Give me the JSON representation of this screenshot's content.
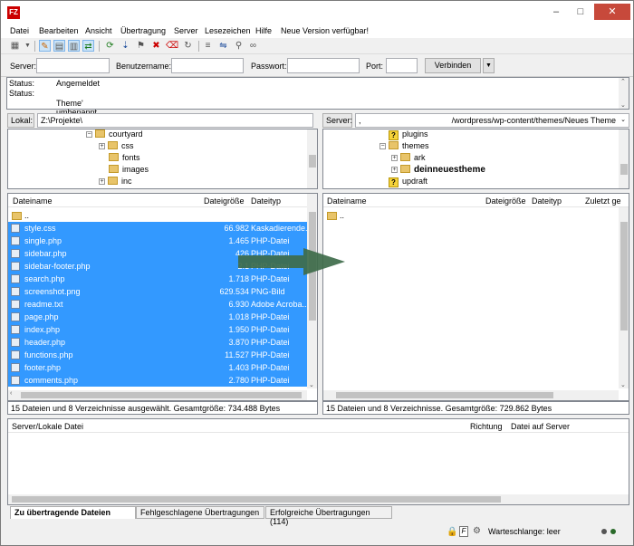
{
  "window": {
    "logo_text": "FZ",
    "controls": {
      "minimize": "–",
      "maximize": "□",
      "close": "✕"
    }
  },
  "menu": [
    "Datei",
    "Bearbeiten",
    "Ansicht",
    "Übertragung",
    "Server",
    "Lesezeichen",
    "Hilfe",
    "Neue Version verfügbar!"
  ],
  "quickconnect": {
    "server_label": "Server:",
    "user_label": "Benutzername:",
    "password_label": "Passwort:",
    "port_label": "Port:",
    "connect_label": "Verbinden",
    "dropdown_glyph": "▼"
  },
  "log": [
    {
      "label": "Status:",
      "text": "Angemeldet"
    },
    {
      "label": "Status:",
      "text": ""
    },
    {
      "label": "",
      "text": "Theme' umbenannt"
    }
  ],
  "local": {
    "label": "Lokal:",
    "path": "Z:\\Projekte\\",
    "tree": [
      {
        "name": "courtyard",
        "expander": "−",
        "icon": "folder"
      },
      {
        "name": "css",
        "expander": "+",
        "icon": "folder"
      },
      {
        "name": "fonts",
        "expander": "",
        "icon": "folder"
      },
      {
        "name": "images",
        "expander": "",
        "icon": "folder"
      },
      {
        "name": "inc",
        "expander": "+",
        "icon": "folder"
      }
    ],
    "columns": {
      "name": "Dateiname",
      "size": "Dateigröße",
      "type": "Dateityp"
    },
    "files": [
      {
        "name": "..",
        "size": "",
        "type": "",
        "selected": false,
        "icon": "folder"
      },
      {
        "name": "style.css",
        "size": "66.982",
        "type": "Kaskadierende...",
        "selected": true,
        "icon": "file"
      },
      {
        "name": "single.php",
        "size": "1.465",
        "type": "PHP-Datei",
        "selected": true,
        "icon": "file"
      },
      {
        "name": "sidebar.php",
        "size": "426",
        "type": "PHP-Datei",
        "selected": true,
        "icon": "file"
      },
      {
        "name": "sidebar-footer.php",
        "size": "2.1",
        "type": "PHP-Datei",
        "selected": true,
        "icon": "file"
      },
      {
        "name": "search.php",
        "size": "1.718",
        "type": "PHP-Datei",
        "selected": true,
        "icon": "file"
      },
      {
        "name": "screenshot.png",
        "size": "629.534",
        "type": "PNG-Bild",
        "selected": true,
        "icon": "file"
      },
      {
        "name": "readme.txt",
        "size": "6.930",
        "type": "Adobe Acroba...",
        "selected": true,
        "icon": "file"
      },
      {
        "name": "page.php",
        "size": "1.018",
        "type": "PHP-Datei",
        "selected": true,
        "icon": "file"
      },
      {
        "name": "index.php",
        "size": "1.950",
        "type": "PHP-Datei",
        "selected": true,
        "icon": "file"
      },
      {
        "name": "header.php",
        "size": "3.870",
        "type": "PHP-Datei",
        "selected": true,
        "icon": "file"
      },
      {
        "name": "functions.php",
        "size": "11.527",
        "type": "PHP-Datei",
        "selected": true,
        "icon": "file"
      },
      {
        "name": "footer.php",
        "size": "1.403",
        "type": "PHP-Datei",
        "selected": true,
        "icon": "file"
      },
      {
        "name": "comments.php",
        "size": "2.780",
        "type": "PHP-Datei",
        "selected": true,
        "icon": "file"
      }
    ],
    "status": "15 Dateien und 8 Verzeichnisse ausgewählt. Gesamtgröße: 734.488 Bytes"
  },
  "remote": {
    "label": "Server:",
    "path_prefix": ",",
    "path": "/wordpress/wp-content/themes/Neues Theme",
    "tree": [
      {
        "name": "plugins",
        "expander": "",
        "icon": "question"
      },
      {
        "name": "themes",
        "expander": "−",
        "icon": "folder"
      },
      {
        "name": "ark",
        "expander": "+",
        "icon": "folder"
      },
      {
        "name": "deinneuestheme",
        "expander": "+",
        "icon": "folder",
        "bold": true
      },
      {
        "name": "updraft",
        "expander": "",
        "icon": "question"
      }
    ],
    "columns": {
      "name": "Dateiname",
      "size": "Dateigröße",
      "type": "Dateityp",
      "modified": "Zuletzt ge"
    },
    "files": [
      {
        "name": "..",
        "icon": "folder"
      }
    ],
    "status": "15 Dateien und 8 Verzeichnisse. Gesamtgröße: 729.862 Bytes"
  },
  "queue": {
    "columns": {
      "file": "Server/Lokale Datei",
      "direction": "Richtung",
      "remote": "Datei auf Server"
    },
    "tabs": [
      "Zu übertragende Dateien",
      "Fehlgeschlagene Übertragungen",
      "Erfolgreiche Übertragungen (114)"
    ]
  },
  "statusbar": {
    "queue": "Warteschlange: leer"
  },
  "colors": {
    "selection": "#3399ff",
    "arrow": "#3e6b4a"
  }
}
